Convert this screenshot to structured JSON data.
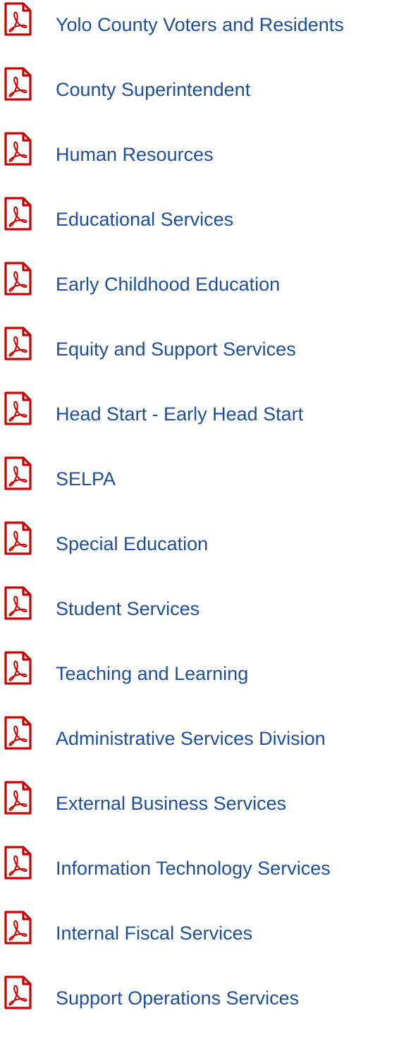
{
  "documents": [
    {
      "label": "Yolo County Voters and Residents",
      "icon": "pdf-file-icon"
    },
    {
      "label": "County Superintendent",
      "icon": "pdf-file-icon"
    },
    {
      "label": "Human Resources",
      "icon": "pdf-file-icon"
    },
    {
      "label": "Educational Services",
      "icon": "pdf-file-icon"
    },
    {
      "label": "Early Childhood Education",
      "icon": "pdf-file-icon"
    },
    {
      "label": "Equity and Support Services",
      "icon": "pdf-file-icon"
    },
    {
      "label": "Head Start - Early Head Start",
      "icon": "pdf-file-icon"
    },
    {
      "label": "SELPA",
      "icon": "pdf-file-icon"
    },
    {
      "label": "Special Education",
      "icon": "pdf-file-icon"
    },
    {
      "label": "Student Services",
      "icon": "pdf-file-icon"
    },
    {
      "label": "Teaching and Learning",
      "icon": "pdf-file-icon"
    },
    {
      "label": "Administrative Services Division",
      "icon": "pdf-file-icon"
    },
    {
      "label": "External Business Services",
      "icon": "pdf-file-icon"
    },
    {
      "label": "Information Technology Services",
      "icon": "pdf-file-icon"
    },
    {
      "label": "Internal Fiscal Services",
      "icon": "pdf-file-icon"
    },
    {
      "label": "Support Operations Services",
      "icon": "pdf-file-icon"
    }
  ],
  "colors": {
    "icon": "#cc0000",
    "link": "#1c4fa0"
  }
}
